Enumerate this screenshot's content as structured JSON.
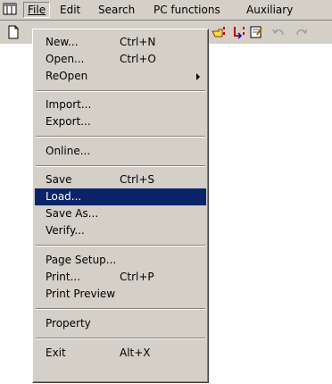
{
  "menubar": {
    "app_icon": "application-window-icon",
    "items": [
      {
        "label": "File",
        "mnemonic_index": 0
      },
      {
        "label": "Edit",
        "mnemonic_index": 0
      },
      {
        "label": "Search",
        "mnemonic_index": 0
      },
      {
        "label": "PC functions",
        "mnemonic_index": 0
      },
      {
        "label": "Auxiliary",
        "mnemonic_index": 0
      }
    ]
  },
  "toolbar": {
    "icons": [
      "new-document-icon",
      "hand-point-icon",
      "ladder-step-icon",
      "notepad-icon",
      "undo-icon",
      "redo-icon"
    ]
  },
  "file_menu": {
    "items": [
      {
        "label": "New...",
        "shortcut": "Ctrl+N"
      },
      {
        "label": "Open...",
        "shortcut": "Ctrl+O"
      },
      {
        "label": "ReOpen",
        "shortcut": "",
        "submenu": true
      },
      {
        "label": "Import...",
        "shortcut": ""
      },
      {
        "label": "Export...",
        "shortcut": ""
      },
      {
        "label": "Online...",
        "shortcut": ""
      },
      {
        "label": "Save",
        "shortcut": "Ctrl+S"
      },
      {
        "label": "Load...",
        "shortcut": "",
        "highlighted": true
      },
      {
        "label": "Save As...",
        "shortcut": ""
      },
      {
        "label": "Verify...",
        "shortcut": ""
      },
      {
        "label": "Page Setup...",
        "shortcut": ""
      },
      {
        "label": "Print...",
        "shortcut": "Ctrl+P"
      },
      {
        "label": "Print Preview",
        "shortcut": ""
      },
      {
        "label": "Property",
        "shortcut": ""
      },
      {
        "label": "Exit",
        "shortcut": "Alt+X"
      }
    ]
  },
  "colors": {
    "chrome": "#d4d0c8",
    "highlight": "#0a246a",
    "highlight_text": "#ffffff"
  }
}
